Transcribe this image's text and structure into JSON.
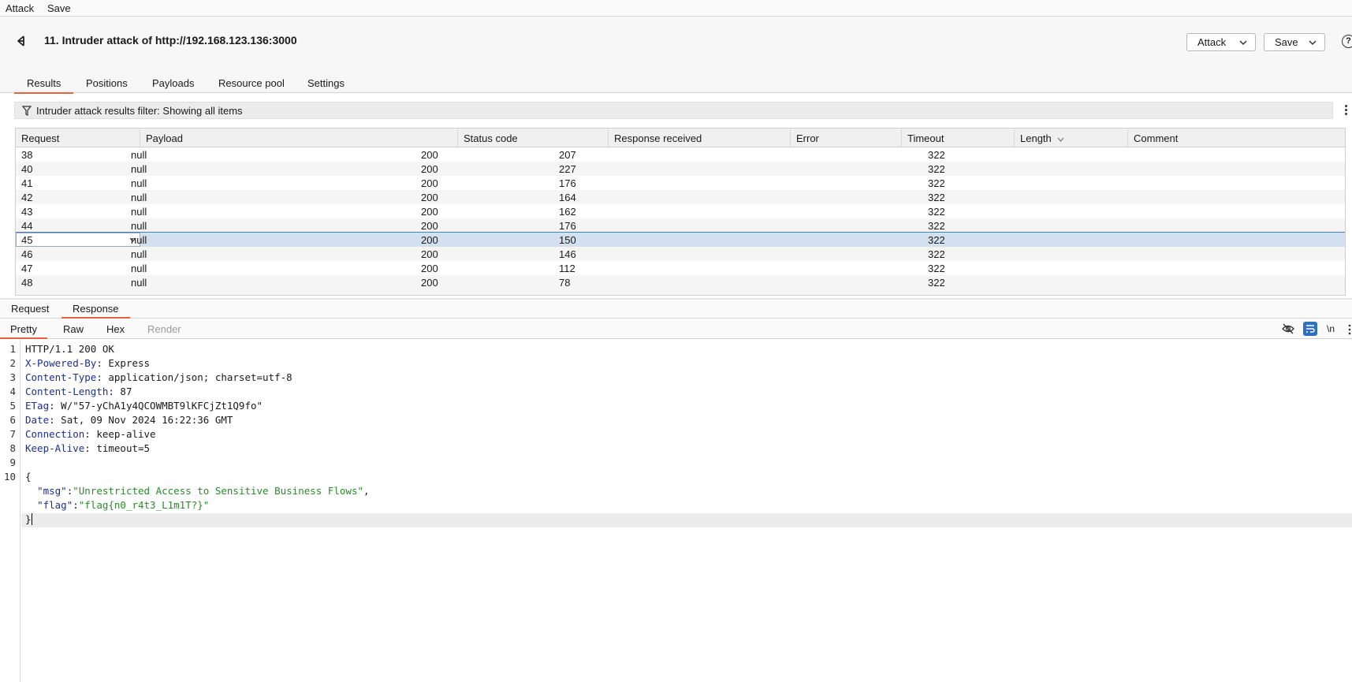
{
  "menu": {
    "attack": "Attack",
    "save": "Save"
  },
  "header": {
    "title": "11. Intruder attack of http://192.168.123.136:3000",
    "attack_button": "Attack",
    "save_button": "Save",
    "help": "?"
  },
  "tabs": [
    "Results",
    "Positions",
    "Payloads",
    "Resource pool",
    "Settings"
  ],
  "filter": {
    "text": "Intruder attack results filter: Showing all items"
  },
  "table": {
    "columns": [
      "Request",
      "Payload",
      "Status code",
      "Response received",
      "Error",
      "Timeout",
      "Length",
      "Comment"
    ],
    "sorted_column": "Length",
    "rows": [
      {
        "request": "38",
        "payload": "null",
        "status": "200",
        "received": "207",
        "error": "",
        "timeout": "",
        "length": "322",
        "comment": ""
      },
      {
        "request": "40",
        "payload": "null",
        "status": "200",
        "received": "227",
        "error": "",
        "timeout": "",
        "length": "322",
        "comment": ""
      },
      {
        "request": "41",
        "payload": "null",
        "status": "200",
        "received": "176",
        "error": "",
        "timeout": "",
        "length": "322",
        "comment": ""
      },
      {
        "request": "42",
        "payload": "null",
        "status": "200",
        "received": "164",
        "error": "",
        "timeout": "",
        "length": "322",
        "comment": ""
      },
      {
        "request": "43",
        "payload": "null",
        "status": "200",
        "received": "162",
        "error": "",
        "timeout": "",
        "length": "322",
        "comment": ""
      },
      {
        "request": "44",
        "payload": "null",
        "status": "200",
        "received": "176",
        "error": "",
        "timeout": "",
        "length": "322",
        "comment": ""
      },
      {
        "request": "45",
        "payload": "null",
        "status": "200",
        "received": "150",
        "error": "",
        "timeout": "",
        "length": "322",
        "comment": "",
        "selected": true
      },
      {
        "request": "46",
        "payload": "null",
        "status": "200",
        "received": "146",
        "error": "",
        "timeout": "",
        "length": "322",
        "comment": ""
      },
      {
        "request": "47",
        "payload": "null",
        "status": "200",
        "received": "112",
        "error": "",
        "timeout": "",
        "length": "322",
        "comment": ""
      },
      {
        "request": "48",
        "payload": "null",
        "status": "200",
        "received": "78",
        "error": "",
        "timeout": "",
        "length": "322",
        "comment": ""
      }
    ]
  },
  "message_tabs": [
    "Request",
    "Response"
  ],
  "view_tabs": [
    "Pretty",
    "Raw",
    "Hex",
    "Render"
  ],
  "toolbar": {
    "newline_toggle": "\\n"
  },
  "response": {
    "line_numbers": [
      "1",
      "2",
      "3",
      "4",
      "5",
      "6",
      "7",
      "8",
      "9",
      "10"
    ],
    "status_line": "HTTP/1.1 200 OK",
    "headers": [
      {
        "name": "X-Powered-By",
        "value": " Express"
      },
      {
        "name": "Content-Type",
        "value": " application/json; charset=utf-8"
      },
      {
        "name": "Content-Length",
        "value": " 87"
      },
      {
        "name": "ETag",
        "value": " W/\"57-yChA1y4QCOWMBT9lKFCjZt1Q9fo\""
      },
      {
        "name": "Date",
        "value": " Sat, 09 Nov 2024 16:22:36 GMT"
      },
      {
        "name": "Connection",
        "value": " keep-alive"
      },
      {
        "name": "Keep-Alive",
        "value": " timeout=5"
      }
    ],
    "body_open": "{",
    "msg_key": "\"msg\"",
    "msg_value": "\"Unrestricted Access to Sensitive Business Flows\"",
    "flag_key": "\"flag\"",
    "flag_value": "\"flag{n0_r4t3_L1m1T?}\"",
    "body_close": "}"
  }
}
